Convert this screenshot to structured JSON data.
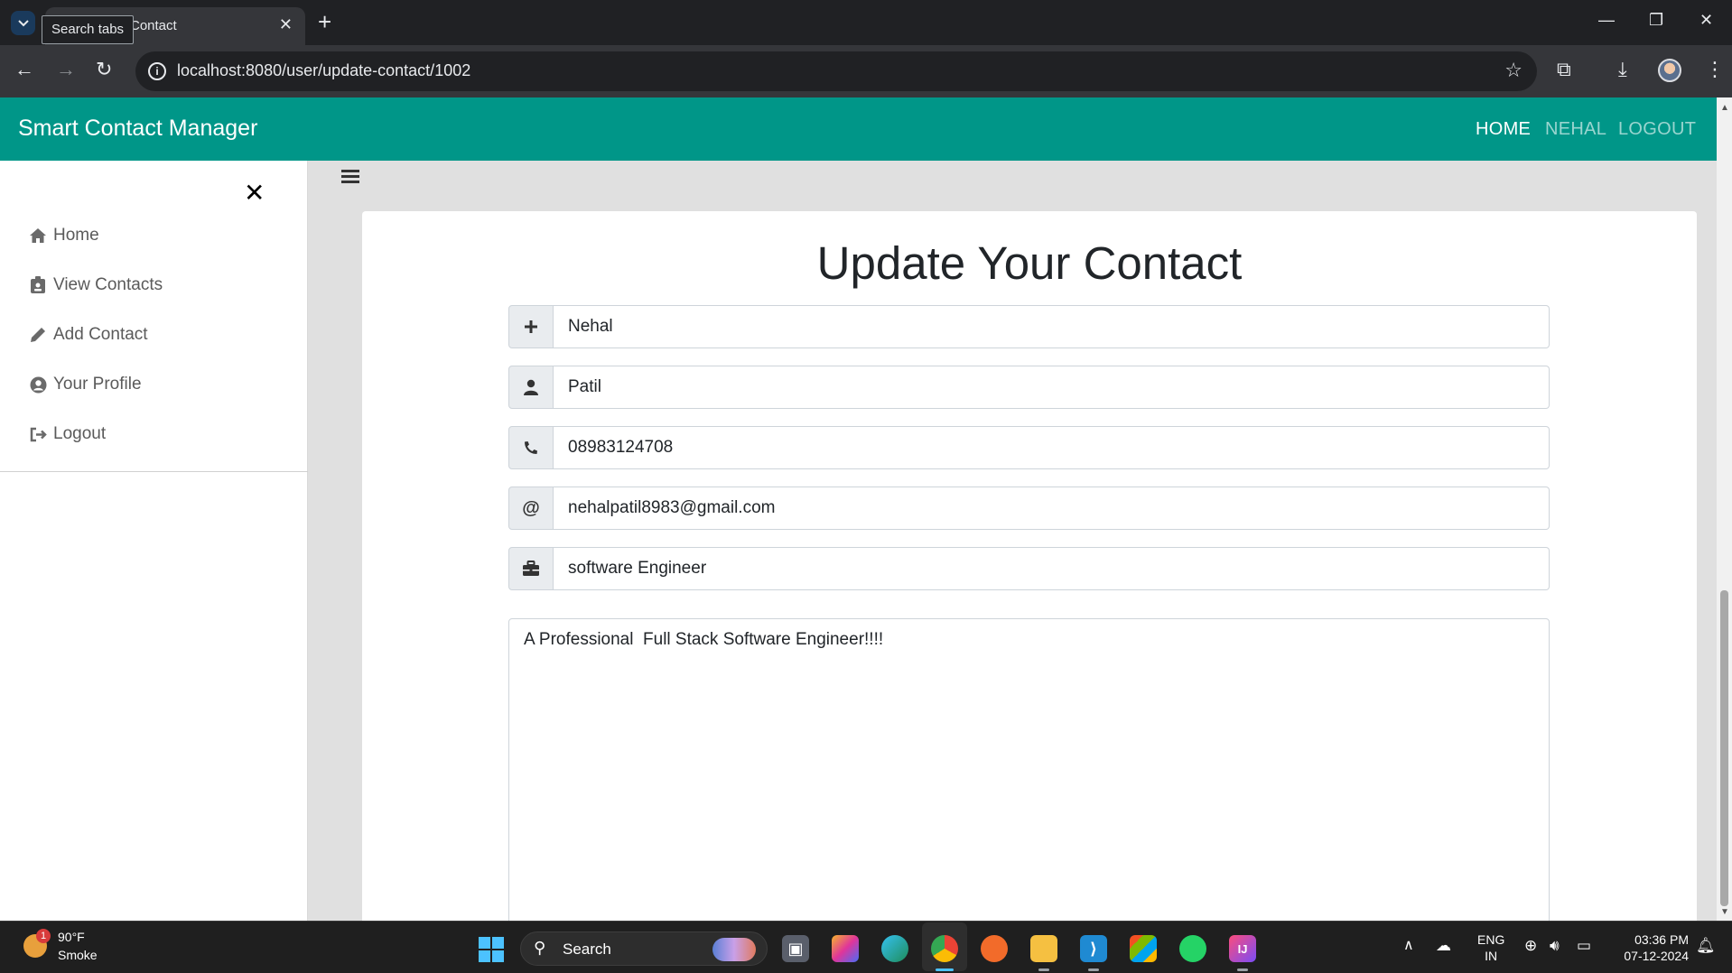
{
  "browser": {
    "tab_title": "Contact",
    "tooltip": "Search tabs",
    "url": "localhost:8080/user/update-contact/1002"
  },
  "app": {
    "brand": "Smart Contact Manager",
    "nav": {
      "home": "HOME",
      "user": "NEHAL",
      "logout": "LOGOUT"
    }
  },
  "sidebar": {
    "items": [
      {
        "label": "Home",
        "icon": "home-icon"
      },
      {
        "label": "View Contacts",
        "icon": "id-badge-icon"
      },
      {
        "label": "Add Contact",
        "icon": "pencil-icon"
      },
      {
        "label": "Your Profile",
        "icon": "user-circle-icon"
      },
      {
        "label": "Logout",
        "icon": "sign-out-icon"
      }
    ]
  },
  "form": {
    "title": "Update Your Contact",
    "fields": {
      "name": {
        "value": "Nehal",
        "icon": "plus-icon"
      },
      "second_name": {
        "value": "Patil",
        "icon": "user-icon"
      },
      "phone": {
        "value": "08983124708",
        "icon": "phone-icon"
      },
      "email": {
        "value": "nehalpatil8983@gmail.com",
        "icon": "at-icon"
      },
      "work": {
        "value": "software Engineer",
        "icon": "briefcase-icon"
      }
    },
    "description": "A Professional  Full Stack Software Engineer!!!!"
  },
  "taskbar": {
    "weather_temp": "90°F",
    "weather_desc": "Smoke",
    "weather_badge": "1",
    "search_label": "Search",
    "lang_line1": "ENG",
    "lang_line2": "IN",
    "time": "03:36 PM",
    "date": "07-12-2024"
  },
  "colors": {
    "navbar": "#009688",
    "page_bg": "#e0e0e0",
    "chrome_dark": "#202124"
  }
}
